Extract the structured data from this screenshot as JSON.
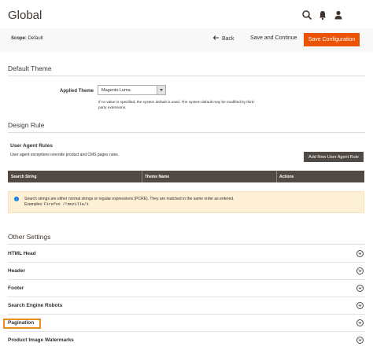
{
  "header": {
    "title": "Global",
    "icons": [
      "search-icon",
      "bell-icon",
      "user-icon"
    ]
  },
  "actions": {
    "scope_label": "Scope:",
    "scope_value": "Default",
    "back_label": "Back",
    "save_continue_label": "Save and Continue",
    "save_config_label": "Save Configuration"
  },
  "default_theme": {
    "title": "Default Theme",
    "applied_label": "Applied Theme",
    "selected": "Magento Luma",
    "note": "If no value is specified, the system default is used. The system default may be modified by third-party extensions."
  },
  "design_rule": {
    "title": "Design Rule",
    "ua_title": "User Agent Rules",
    "ua_desc": "User agent exceptions override product and CMS pages rules.",
    "add_button": "Add New User Agent Rule",
    "columns": [
      "Search String",
      "Theme Name",
      "Actions"
    ],
    "message_line1": "Search strings are either normal strings or regular expressions (PCRE). They are matched in the same order as entered.",
    "message_examples_label": "Examples:",
    "message_examples_code": "Firefox /^mozilla/i"
  },
  "other_settings": {
    "title": "Other Settings",
    "items": [
      "HTML Head",
      "Header",
      "Footer",
      "Search Engine Robots",
      "Pagination",
      "Product Image Watermarks"
    ]
  },
  "colors": {
    "accent": "#eb5202",
    "dark": "#514943",
    "highlight": "#eb8c1e",
    "message_bg": "#fdf0d5"
  }
}
